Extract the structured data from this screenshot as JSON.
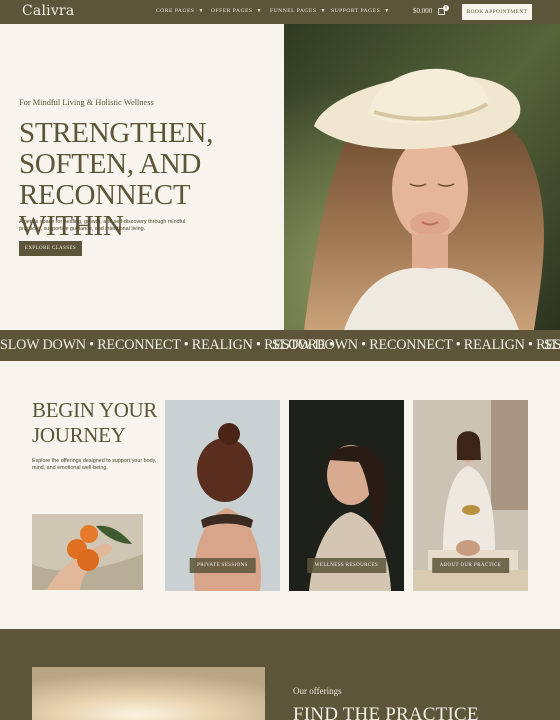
{
  "header": {
    "logo": "Calivra",
    "nav": [
      {
        "label": "CORE PAGES"
      },
      {
        "label": "OFFER PAGES"
      },
      {
        "label": "FUNNEL PAGES"
      },
      {
        "label": "SUPPORT PAGES"
      }
    ],
    "cart_total": "$0.000",
    "cart_count": "0",
    "book_button": "BOOK APPOINTMENT"
  },
  "hero": {
    "kicker": "For Mindful Living & Holistic Wellness",
    "headline": "STRENGTHEN, SOFTEN, AND RECONNECT WITHIN",
    "description": "A gentle space for healing, growth, and self-discovery through mindful practices, supportive guidance, and intentional living.",
    "cta": "EXPLORE CLASSES"
  },
  "marquee": {
    "text": "SLOW DOWN • RECONNECT • REALIGN • RESTORE •"
  },
  "journey": {
    "title": "BEGIN YOUR JOURNEY",
    "description": "Explore the offerings designed to support your body, mind, and emotional well-being.",
    "cards": [
      {
        "label": "PRIVATE SESSIONS"
      },
      {
        "label": "WELLNESS RESOURCES"
      },
      {
        "label": "ABOUT OUR PRACTICE"
      }
    ]
  },
  "offerings": {
    "kicker": "Our offerings",
    "title": "FIND THE PRACTICE"
  },
  "colors": {
    "brand_olive": "#5c5539",
    "cream": "#f7f4ee"
  }
}
